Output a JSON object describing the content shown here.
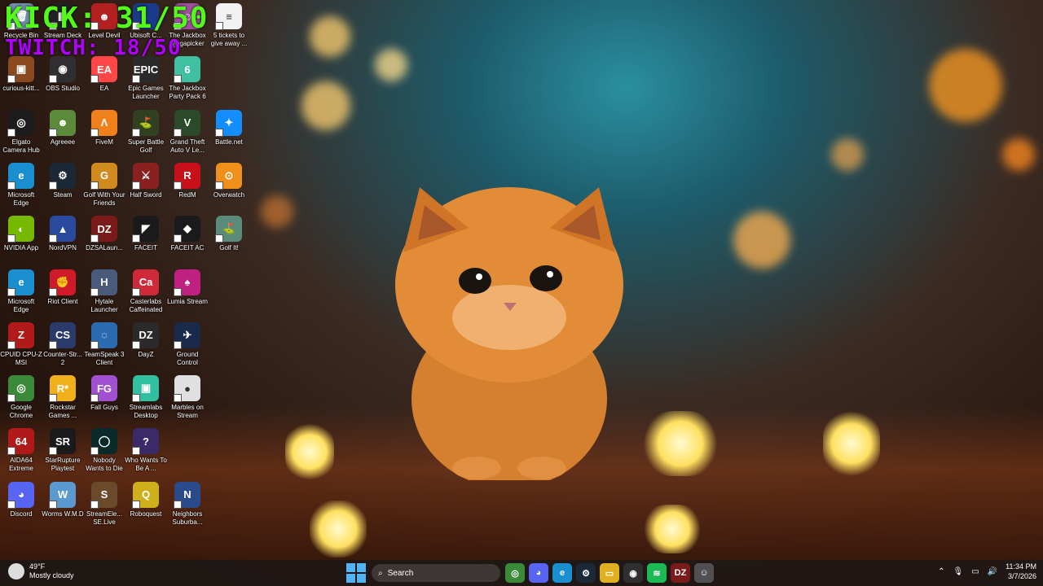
{
  "overlay": {
    "kick": "KICK: 31/50",
    "twitch": "TWITCH: 18/50"
  },
  "desktop_icons": [
    {
      "label": "Recycle Bin",
      "icon": "recycle-bin-icon",
      "color": "#6f8fa8",
      "glyph": "🗑"
    },
    {
      "label": "Stream Deck",
      "icon": "stream-deck-icon",
      "color": "#222",
      "glyph": "▦"
    },
    {
      "label": "Level Devil",
      "icon": "level-devil-icon",
      "color": "#b32020",
      "glyph": "☻"
    },
    {
      "label": "Ubisoft C...",
      "icon": "ubisoft-icon",
      "color": "#1a3a8a",
      "glyph": "◐"
    },
    {
      "label": "The Jackbox Megapicker",
      "icon": "jackbox-megapicker-icon",
      "color": "#a050a0",
      "glyph": "☺"
    },
    {
      "label": "5 tickets to give away ...",
      "icon": "text-file-icon",
      "color": "#f2f2f2",
      "glyph": "≡"
    },
    {
      "label": "curious-kitt...",
      "icon": "image-file-icon",
      "color": "#8a4a20",
      "glyph": "▣"
    },
    {
      "label": "OBS Studio",
      "icon": "obs-icon",
      "color": "#302e31",
      "glyph": "◉"
    },
    {
      "label": "EA",
      "icon": "ea-icon",
      "color": "#ff4747",
      "glyph": "EA"
    },
    {
      "label": "Epic Games Launcher",
      "icon": "epic-games-icon",
      "color": "#2a2a2a",
      "glyph": "EPIC"
    },
    {
      "label": "The Jackbox Party Pack 6",
      "icon": "jackbox-pack6-icon",
      "color": "#40c0a0",
      "glyph": "6"
    },
    {
      "label": "Elgato Camera Hub",
      "icon": "elgato-icon",
      "color": "#1c1c1c",
      "glyph": "◎"
    },
    {
      "label": "Agreeee",
      "icon": "minecraft-icon",
      "color": "#5a8a3a",
      "glyph": "☻"
    },
    {
      "label": "FiveM",
      "icon": "fivem-icon",
      "color": "#f0801a",
      "glyph": "Λ"
    },
    {
      "label": "Super Battle Golf",
      "icon": "super-battle-golf-icon",
      "color": "#304020",
      "glyph": "⛳"
    },
    {
      "label": "Grand Theft Auto V Le...",
      "icon": "gta-v-icon",
      "color": "#2a4a2a",
      "glyph": "V"
    },
    {
      "label": "Battle.net",
      "icon": "battlenet-icon",
      "color": "#148eff",
      "glyph": "✦"
    },
    {
      "label": "Microsoft Edge",
      "icon": "edge-icon",
      "color": "#1a8fd0",
      "glyph": "e"
    },
    {
      "label": "Steam",
      "icon": "steam-icon",
      "color": "#1b2838",
      "glyph": "⚙"
    },
    {
      "label": "Golf With Your Friends",
      "icon": "golf-with-friends-icon",
      "color": "#d08a20",
      "glyph": "G"
    },
    {
      "label": "Half Sword",
      "icon": "half-sword-icon",
      "color": "#8a2020",
      "glyph": "⚔"
    },
    {
      "label": "RedM",
      "icon": "redm-icon",
      "color": "#c8101a",
      "glyph": "R"
    },
    {
      "label": "Overwatch",
      "icon": "overwatch-icon",
      "color": "#f0901a",
      "glyph": "⊙"
    },
    {
      "label": "NVIDIA App",
      "icon": "nvidia-icon",
      "color": "#76b900",
      "glyph": "◐"
    },
    {
      "label": "NordVPN",
      "icon": "nordvpn-icon",
      "color": "#2a4aa0",
      "glyph": "▲"
    },
    {
      "label": "DZSALaun...",
      "icon": "dzsa-icon",
      "color": "#7a1a1a",
      "glyph": "DZ"
    },
    {
      "label": "FACEIT",
      "icon": "faceit-icon",
      "color": "#1a1a1a",
      "glyph": "◤"
    },
    {
      "label": "FACEIT AC",
      "icon": "faceit-ac-icon",
      "color": "#1a1a1a",
      "glyph": "◆"
    },
    {
      "label": "Golf It!",
      "icon": "golf-it-icon",
      "color": "#5a8a7a",
      "glyph": "⛳"
    },
    {
      "label": "Microsoft Edge",
      "icon": "edge-icon",
      "color": "#1a8fd0",
      "glyph": "e"
    },
    {
      "label": "Riot Client",
      "icon": "riot-client-icon",
      "color": "#d01a2a",
      "glyph": "✊"
    },
    {
      "label": "Hytale Launcher",
      "icon": "hytale-icon",
      "color": "#4a5a7a",
      "glyph": "H"
    },
    {
      "label": "Casterlabs Caffeinated",
      "icon": "casterlabs-icon",
      "color": "#d02a3a",
      "glyph": "Ca"
    },
    {
      "label": "Lumia Stream",
      "icon": "lumia-icon",
      "color": "#c02080",
      "glyph": "♠"
    },
    {
      "label": "CPUID CPU-Z MSI",
      "icon": "cpuz-icon",
      "color": "#b01a1a",
      "glyph": "Z"
    },
    {
      "label": "Counter-Str... 2",
      "icon": "cs2-icon",
      "color": "#2a3a6a",
      "glyph": "CS"
    },
    {
      "label": "TeamSpeak 3 Client",
      "icon": "teamspeak-icon",
      "color": "#2a6ab0",
      "glyph": "◌"
    },
    {
      "label": "DayZ",
      "icon": "dayz-icon",
      "color": "#2a2a2a",
      "glyph": "DZ"
    },
    {
      "label": "Ground Control",
      "icon": "ground-control-icon",
      "color": "#1a2a4a",
      "glyph": "✈"
    },
    {
      "label": "Google Chrome",
      "icon": "chrome-icon",
      "color": "#3a8a3a",
      "glyph": "◎"
    },
    {
      "label": "Rockstar Games ...",
      "icon": "rockstar-icon",
      "color": "#f0b01a",
      "glyph": "R*"
    },
    {
      "label": "Fall Guys",
      "icon": "fall-guys-icon",
      "color": "#a050d0",
      "glyph": "FG"
    },
    {
      "label": "Streamlabs Desktop",
      "icon": "streamlabs-icon",
      "color": "#30c0a0",
      "glyph": "▣"
    },
    {
      "label": "Marbles on Stream",
      "icon": "marbles-icon",
      "color": "#e0e0e0",
      "glyph": "●"
    },
    {
      "label": "AIDA64 Extreme",
      "icon": "aida64-icon",
      "color": "#b01a1a",
      "glyph": "64"
    },
    {
      "label": "StarRupture Playtest",
      "icon": "starrupture-icon",
      "color": "#1a1a1a",
      "glyph": "SR"
    },
    {
      "label": "Nobody Wants to Die",
      "icon": "nobody-wants-to-die-icon",
      "color": "#0a2a2a",
      "glyph": "◯"
    },
    {
      "label": "Who Wants To Be A ...",
      "icon": "who-wants-icon",
      "color": "#3a2a6a",
      "glyph": "?"
    },
    {
      "label": "Discord",
      "icon": "discord-icon",
      "color": "#5865f2",
      "glyph": "◕"
    },
    {
      "label": "Worms W.M.D",
      "icon": "worms-icon",
      "color": "#5a9ad0",
      "glyph": "W"
    },
    {
      "label": "StreamEle... SE.Live",
      "icon": "streamelements-icon",
      "color": "#6a4a2a",
      "glyph": "S"
    },
    {
      "label": "Roboquest",
      "icon": "roboquest-icon",
      "color": "#d0b01a",
      "glyph": "Q"
    },
    {
      "label": "Neighbors Suburba...",
      "icon": "neighbors-icon",
      "color": "#2a4a8a",
      "glyph": "N"
    }
  ],
  "weather": {
    "temp": "49°F",
    "condition": "Mostly cloudy"
  },
  "taskbar": {
    "search_placeholder": "Search",
    "apps": [
      {
        "name": "chrome",
        "color": "#3a8a3a",
        "glyph": "◎"
      },
      {
        "name": "discord",
        "color": "#5865f2",
        "glyph": "◕"
      },
      {
        "name": "edge",
        "color": "#1a8fd0",
        "glyph": "e"
      },
      {
        "name": "steam",
        "color": "#1b2838",
        "glyph": "⚙"
      },
      {
        "name": "file-explorer",
        "color": "#e0b020",
        "glyph": "▭"
      },
      {
        "name": "obs",
        "color": "#302e31",
        "glyph": "◉"
      },
      {
        "name": "spotify",
        "color": "#1db954",
        "glyph": "≋"
      },
      {
        "name": "dzsa",
        "color": "#7a1a1a",
        "glyph": "DZ"
      },
      {
        "name": "jackbox",
        "color": "#505050",
        "glyph": "☺"
      }
    ]
  },
  "clock": {
    "time": "11:34 PM",
    "date": "3/7/2026"
  }
}
